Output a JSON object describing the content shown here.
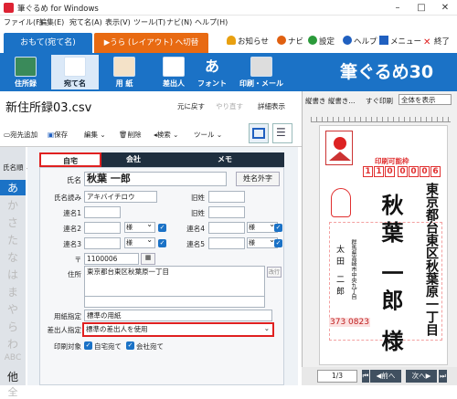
{
  "window": {
    "title": "筆ぐるめ for Windows"
  },
  "menu": [
    "ファイル(F)",
    "編集(E)",
    "宛て名(A)",
    "表示(V)",
    "ツール(T)",
    "ナビ(N)",
    "ヘルプ(H)"
  ],
  "tabs": {
    "omote": "おもて(宛て名)",
    "ura": "▶うら (レイアウト) へ切替"
  },
  "topbar": {
    "oshirase": "お知らせ",
    "navi": "ナビ",
    "settings": "設定",
    "help": "ヘルプ",
    "menu": "メニュー",
    "exit": "終了"
  },
  "ribbon": {
    "items": [
      "住所録",
      "宛て名",
      "用 紙",
      "差出人",
      "フォント",
      "印刷・メール"
    ],
    "brand": "筆ぐるめ30"
  },
  "file": {
    "name": "新住所録03.csv",
    "undo": "元に戻す",
    "redo": "やり直す",
    "detail": "詳細表示"
  },
  "toolbar": {
    "add": "宛先追加",
    "save": "保存",
    "edit": "編集",
    "delete": "削除",
    "search": "検索",
    "tool": "ツール"
  },
  "sidebar": {
    "sort_label": "氏名順",
    "letters": [
      "あ",
      "か",
      "さ",
      "た",
      "な",
      "は",
      "ま",
      "や",
      "ら",
      "わ",
      "ABC",
      "他",
      "全"
    ]
  },
  "form": {
    "tabs": [
      "自宅",
      "会社",
      "メモ"
    ],
    "labels": {
      "name": "氏名",
      "kana": "氏名読み",
      "ren1": "連名1",
      "ren2": "連名2",
      "ren3": "連名3",
      "kyusei": "旧姓",
      "ren4": "連名4",
      "ren5": "連名5",
      "zip": "〒",
      "address": "住所",
      "paper": "用紙指定",
      "sender": "差出人指定",
      "print_target": "印刷対象"
    },
    "values": {
      "name": "秋葉 一郎",
      "kana": "アキバイチロウ",
      "zip": "1100006",
      "address": "東京都台東区秋葉原一丁目",
      "paper": "標準の用紙",
      "sender": "標準の差出人を使用"
    },
    "combo": "様",
    "buttons": {
      "gaiji": "姓名外字",
      "kaigyo": "改行"
    },
    "print": {
      "home": "自宅宛て",
      "company": "会社宛て"
    }
  },
  "preview": {
    "toolbar": {
      "mode": "縦書き 縦書き...",
      "print": "すぐ印刷",
      "zoom": "全体を表示"
    },
    "card_label": "印刷可能枠",
    "zip_digits": [
      "1",
      "1",
      "0",
      "0",
      "0",
      "0",
      "6"
    ],
    "address": "東京都台東区秋葉原一丁目",
    "recipient": "秋葉 一郎 様",
    "sender_address": "群馬県高崎市中央九丁目",
    "sender_name": "太田 二郎",
    "sender_zip": "373 0823",
    "page": "1/3",
    "prev": "前へ",
    "next": "次へ"
  }
}
